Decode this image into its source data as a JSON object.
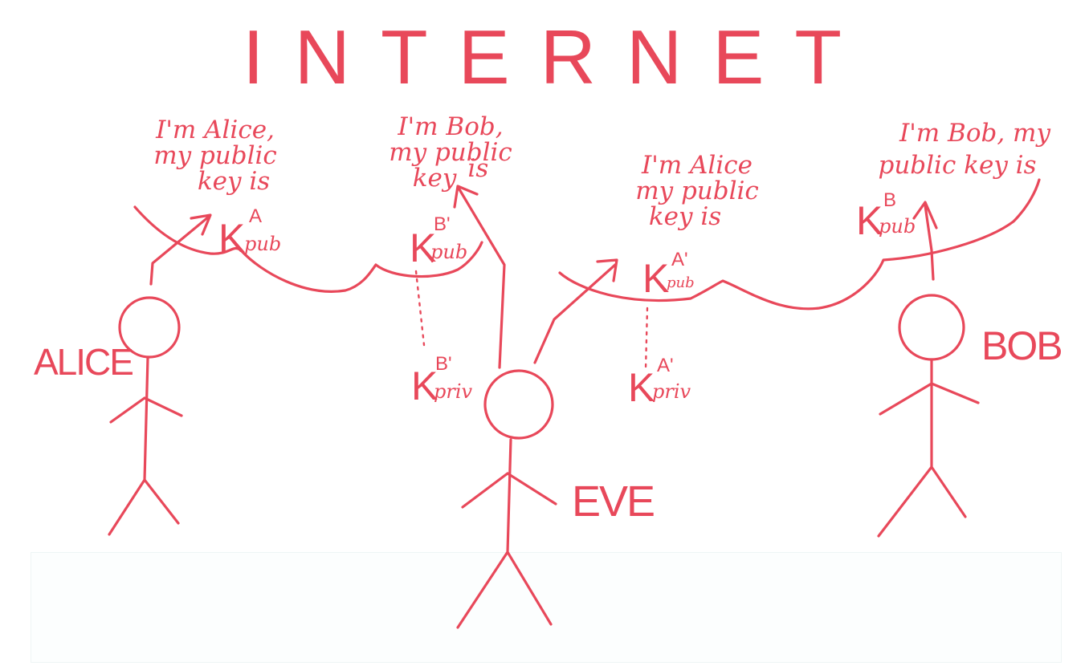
{
  "title": "INTERNET",
  "colors": {
    "ink": "#e8485a",
    "paper": "#ffffff"
  },
  "people": {
    "alice": "ALICE",
    "eve": "EVE",
    "bob": "BOB"
  },
  "messages": [
    {
      "lines": [
        "I'm Alice,",
        "my public",
        "key is"
      ]
    },
    {
      "lines": [
        "I'm Bob,",
        "my public",
        "key",
        "is"
      ]
    },
    {
      "lines": [
        "I'm Alice",
        "my public",
        "key is"
      ]
    },
    {
      "lines": [
        "I'm Bob, my",
        "public key is"
      ]
    }
  ],
  "keys": [
    {
      "base": "K",
      "sup": "A",
      "sub": "pub"
    },
    {
      "base": "K",
      "sup": "B'",
      "sub": "pub"
    },
    {
      "base": "K",
      "sup": "A'",
      "sub": "pub"
    },
    {
      "base": "K",
      "sup": "B",
      "sub": "pub"
    },
    {
      "base": "K",
      "sup": "B'",
      "sub": "priv"
    },
    {
      "base": "K",
      "sup": "A'",
      "sub": "priv"
    }
  ]
}
